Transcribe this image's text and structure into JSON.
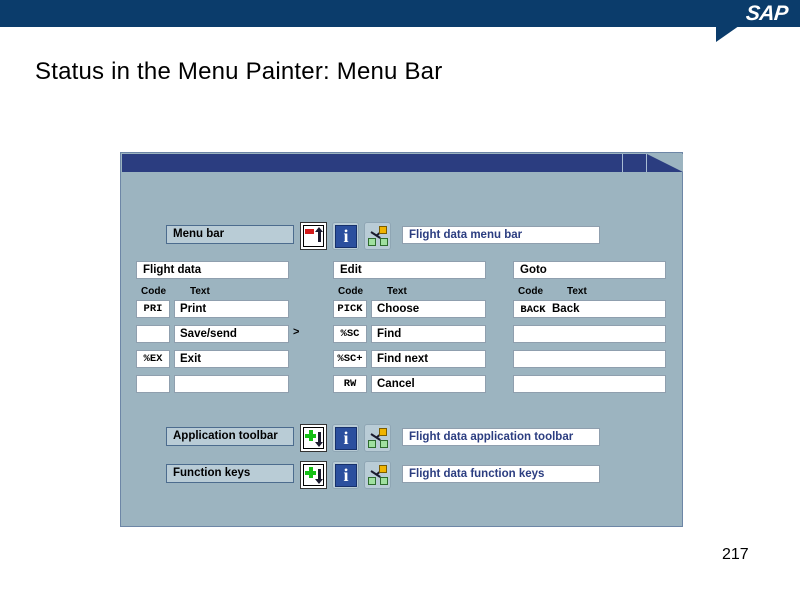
{
  "banner": {
    "logo_text": "SAP",
    "brand_color": "#0b3c6b"
  },
  "slide": {
    "title": "Status in the Menu Painter: Menu Bar",
    "page_number": "217"
  },
  "gui": {
    "window_background": "#9cb4c0",
    "titlebar_color": "#2b3d80",
    "status_row": {
      "label": "Menu bar",
      "description": "Flight data menu bar",
      "icons": [
        {
          "name": "page-red-bar-up-arrow-icon"
        },
        {
          "name": "info-icon"
        },
        {
          "name": "hierarchy-network-icon"
        }
      ]
    },
    "menus": [
      {
        "title": "Flight data",
        "col_code_header": "Code",
        "col_text_header": "Text",
        "rows": [
          {
            "code": "PRI",
            "text": "Print",
            "submenu": ""
          },
          {
            "code": "",
            "text": "Save/send",
            "submenu": ">"
          },
          {
            "code": "%EX",
            "text": "Exit",
            "submenu": ""
          },
          {
            "code": "",
            "text": "",
            "submenu": ""
          }
        ]
      },
      {
        "title": "Edit",
        "col_code_header": "Code",
        "col_text_header": "Text",
        "rows": [
          {
            "code": "PICK",
            "text": "Choose",
            "submenu": ""
          },
          {
            "code": "%SC",
            "text": "Find",
            "submenu": ""
          },
          {
            "code": "%SC+",
            "text": "Find next",
            "submenu": ""
          },
          {
            "code": "RW",
            "text": "Cancel",
            "submenu": ""
          }
        ]
      },
      {
        "title": "Goto",
        "col_code_header": "Code",
        "col_text_header": "Text",
        "rows": [
          {
            "code": "BACK",
            "text": "Back",
            "submenu": ""
          },
          {
            "code": "",
            "text": "",
            "submenu": ""
          },
          {
            "code": "",
            "text": "",
            "submenu": ""
          },
          {
            "code": "",
            "text": "",
            "submenu": ""
          }
        ]
      }
    ],
    "bottom_rows": [
      {
        "label": "Application toolbar",
        "description": "Flight data application toolbar",
        "icons": [
          {
            "name": "page-green-plus-down-arrow-icon"
          },
          {
            "name": "info-icon"
          },
          {
            "name": "hierarchy-network-icon"
          }
        ]
      },
      {
        "label": "Function keys",
        "description": "Flight data function keys",
        "icons": [
          {
            "name": "page-green-plus-down-arrow-icon"
          },
          {
            "name": "info-icon"
          },
          {
            "name": "hierarchy-network-icon"
          }
        ]
      }
    ]
  }
}
